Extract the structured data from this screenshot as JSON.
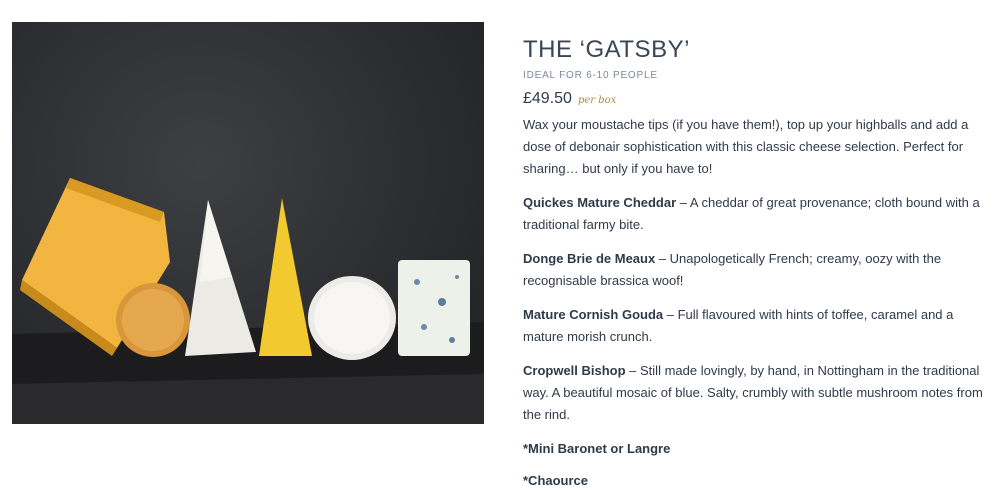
{
  "product": {
    "title": "THE ‘GATSBY’",
    "subtitle": "IDEAL FOR 6-10 PEOPLE",
    "price": "£49.50",
    "per_label": "per box",
    "description": "Wax your moustache tips (if you have them!), top up your highballs and add a dose of debonair sophistication with this classic cheese selection.   Perfect for sharing… but only if you have to!"
  },
  "cheeses": [
    {
      "name": "Quickes Mature Cheddar",
      "text": " – A cheddar of great provenance; cloth bound with a traditional farmy bite."
    },
    {
      "name": "Donge Brie de Meaux",
      "text": " – Unapologetically French; creamy, oozy with the recognisable brassica woof!"
    },
    {
      "name": "Mature Cornish Gouda",
      "text": " – Full flavoured with hints of toffee, caramel and a mature morish crunch."
    },
    {
      "name": "Cropwell Bishop",
      "text": " – Still made lovingly, by hand, in Nottingham in the traditional way.  A beautiful mosaic of blue.  Salty, crumbly with subtle mushroom notes from the rind."
    }
  ],
  "extras": [
    "*Mini Baronet or Langre",
    "*Chaource"
  ]
}
